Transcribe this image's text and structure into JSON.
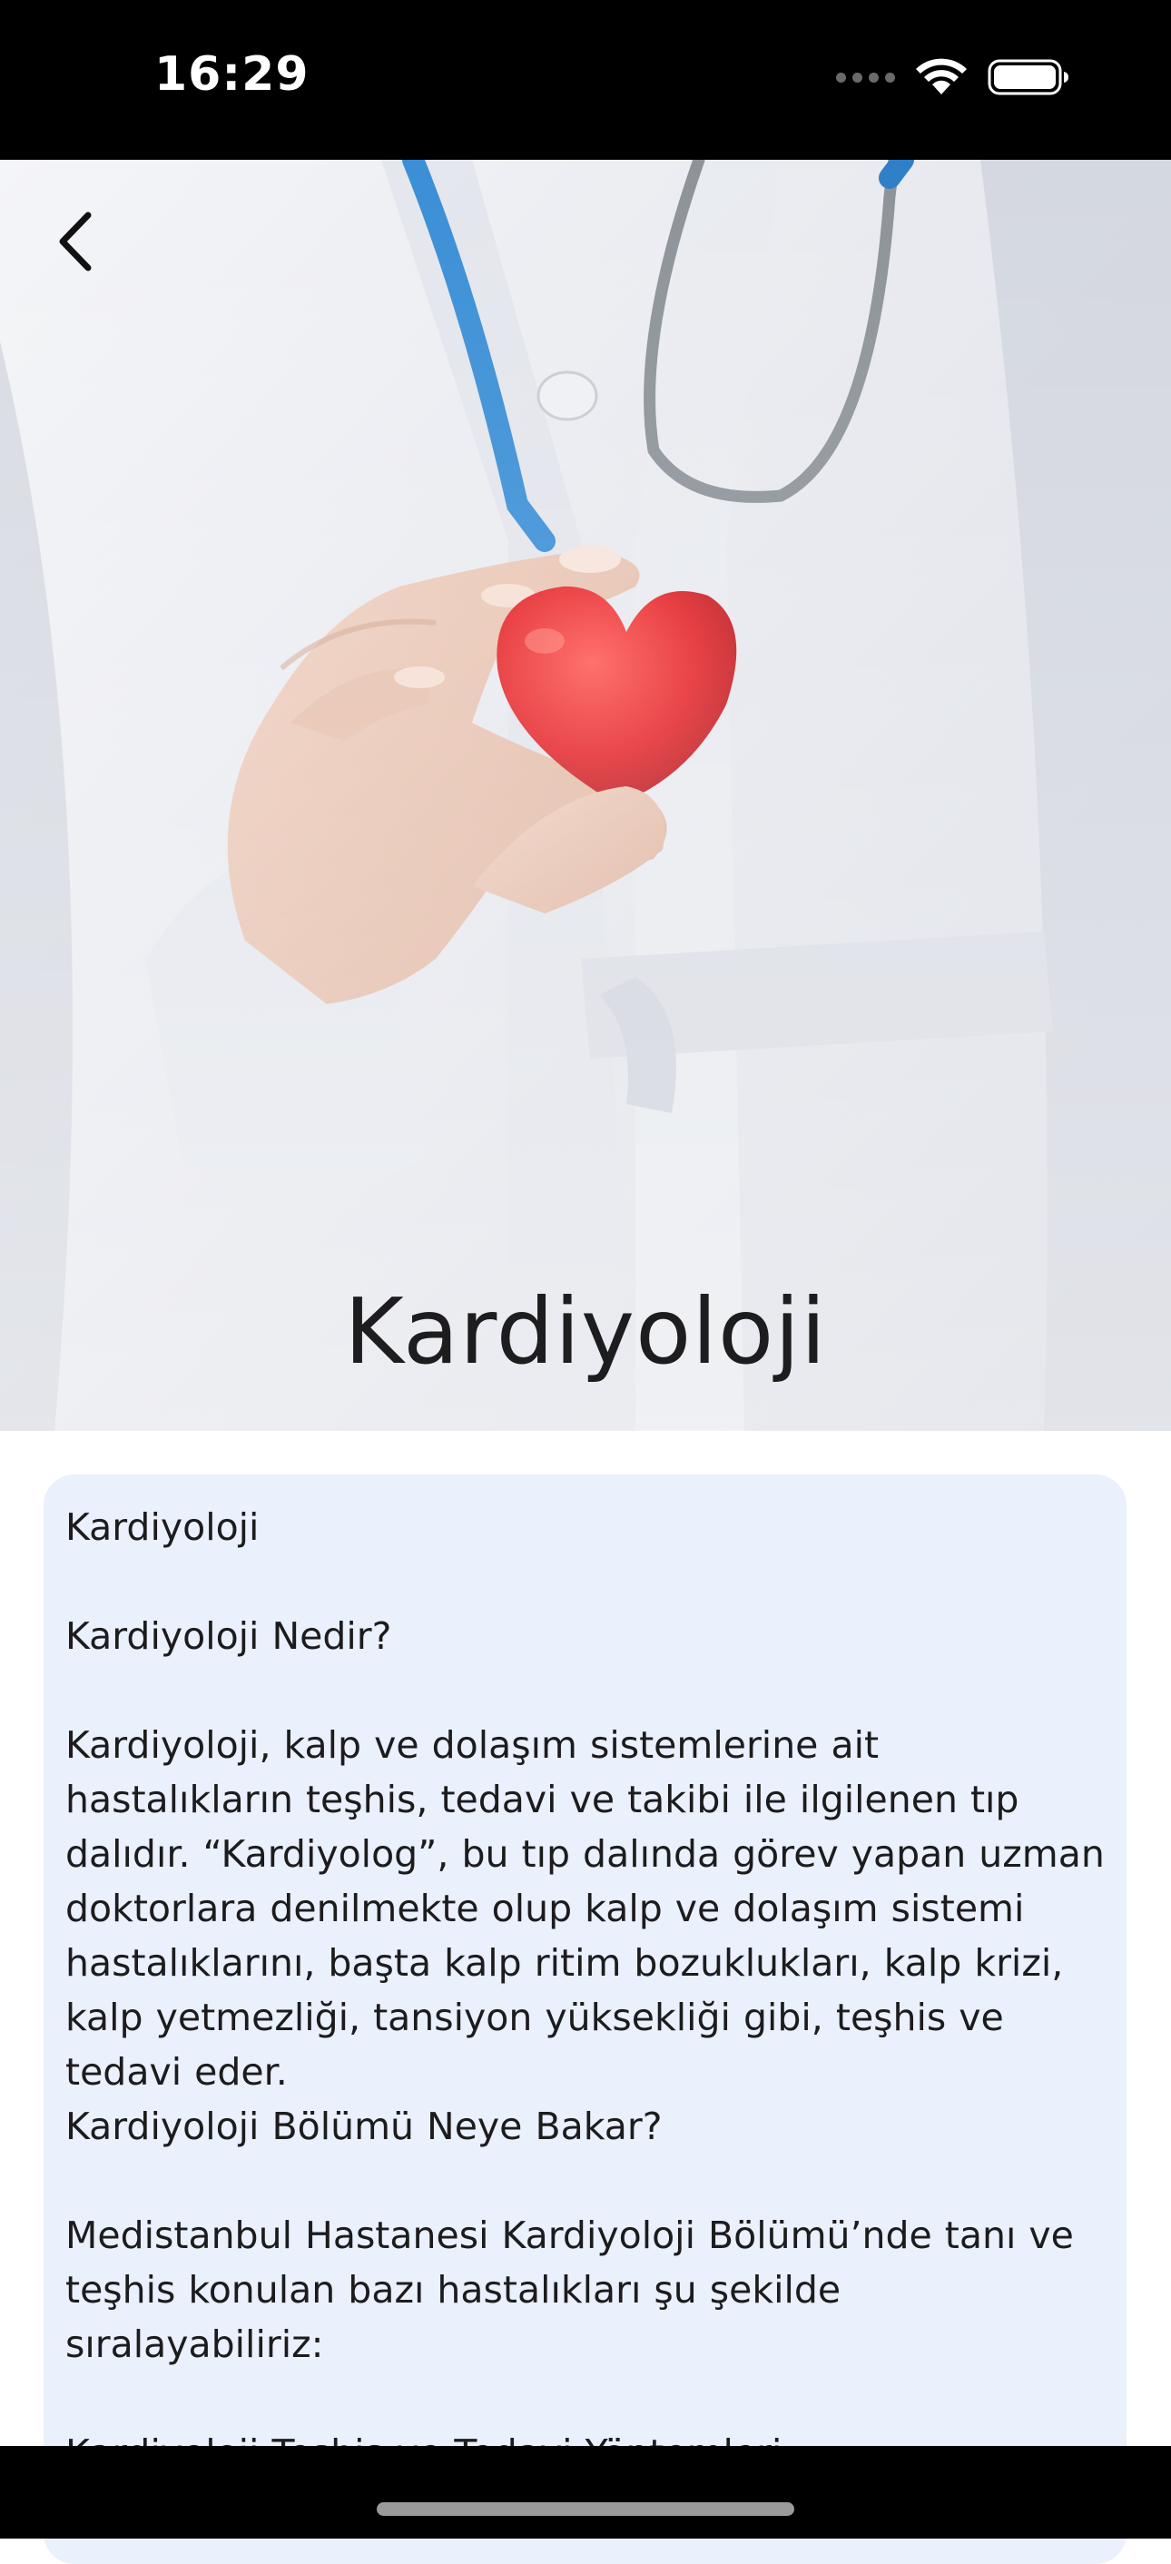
{
  "status_bar": {
    "time": "16:29",
    "icons": [
      "cellular-dots-icon",
      "wifi-icon",
      "battery-icon"
    ]
  },
  "header": {
    "back_icon": "chevron-left-icon",
    "title": "Kardiyoloji",
    "hero_image": "doctor-holding-red-heart-photo"
  },
  "content": {
    "text": "Kardiyoloji\n\nKardiyoloji Nedir?\n\nKardiyoloji, kalp ve dolaşım sistemlerine ait hastalıkların teşhis, tedavi ve takibi ile ilgilenen tıp dalıdır. “Kardiyolog”, bu tıp dalında görev yapan uzman doktorlara denilmekte olup kalp ve dolaşım sistemi hastalıklarını, başta kalp ritim bozuklukları, kalp krizi, kalp yetmezliği, tansiyon yüksekliği gibi, teşhis ve tedavi eder.\nKardiyoloji Bölümü Neye Bakar?\n\nMedistanbul Hastanesi Kardiyoloji Bölümü’nde tanı ve teşhis konulan bazı hastalıkları şu şekilde sıralayabiliriz:\n\nKardiyoloji Teşhis ve Tedavi Yöntemleri"
  },
  "colors": {
    "card_background": "#eaf0fc",
    "status_bar": "#000000",
    "heart": "#e5252a",
    "stethoscope_tube": "#3b8fd6"
  }
}
